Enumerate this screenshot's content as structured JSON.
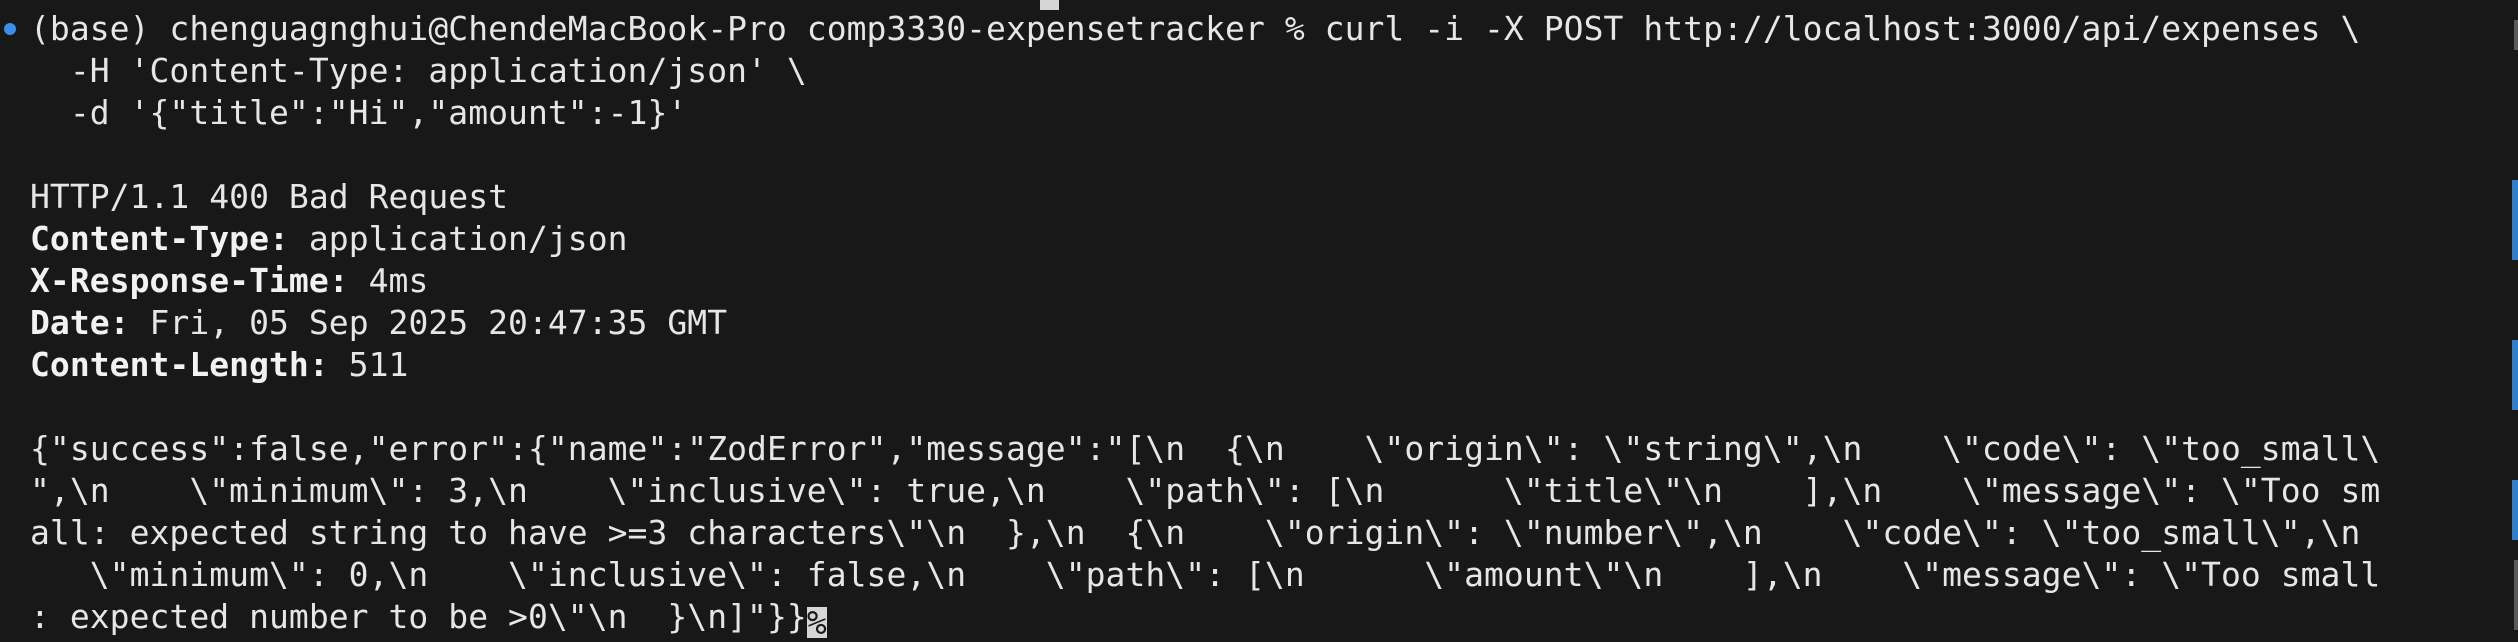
{
  "terminal": {
    "top_partial_line": "(base) chenguagnghui@ChendeMacBook-Pro comp3330-expensetracker % curl -i -X POST http://localhost:3000/api/expenses",
    "prompt": "(base) chenguagnghui@ChendeMacBook-Pro comp3330-expensetracker % ",
    "command_line_1": "curl -i -X POST http://localhost:3000/api/expenses \\",
    "command_line_2": "  -H 'Content-Type: application/json' \\",
    "command_line_3": "  -d '{\"title\":\"Hi\",\"amount\":-1}'",
    "status_line": "HTTP/1.1 400 Bad Request",
    "headers": [
      {
        "key": "Content-Type:",
        "value": " application/json"
      },
      {
        "key": "X-Response-Time:",
        "value": " 4ms"
      },
      {
        "key": "Date:",
        "value": " Fri, 05 Sep 2025 20:47:35 GMT"
      },
      {
        "key": "Content-Length:",
        "value": " 511"
      }
    ],
    "body_lines": [
      "{\"success\":false,\"error\":{\"name\":\"ZodError\",\"message\":\"[\\n  {\\n    \\\"origin\\\": \\\"string\\\",\\n    \\\"code\\\": \\\"too_small\\",
      "\",\\n    \\\"minimum\\\": 3,\\n    \\\"inclusive\\\": true,\\n    \\\"path\\\": [\\n      \\\"title\\\"\\n    ],\\n    \\\"message\\\": \\\"Too sm",
      "all: expected string to have >=3 characters\\\"\\n  },\\n  {\\n    \\\"origin\\\": \\\"number\\\",\\n    \\\"code\\\": \\\"too_small\\\",\\n",
      "   \\\"minimum\\\": 0,\\n    \\\"inclusive\\\": false,\\n    \\\"path\\\": [\\n      \\\"amount\\\"\\n    ],\\n    \\\"message\\\": \\\"Too small",
      ": expected number to be >0\\\"\\n  }\\n]\"}}"
    ],
    "end_marker": "%"
  },
  "colors": {
    "background": "#181818",
    "foreground": "#e6e6e6",
    "prompt_dot": "#3b8eea",
    "scroll_mark": "#2f7fd1"
  }
}
